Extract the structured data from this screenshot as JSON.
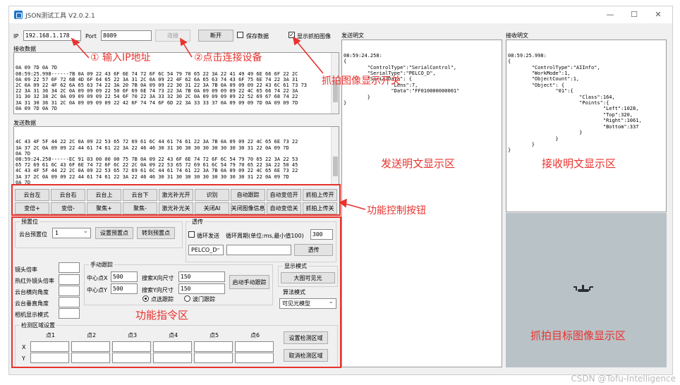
{
  "window": {
    "title": "JSON测试工具 V2.0.2.1",
    "minimize": "—",
    "maximize": "☐",
    "close": "✕"
  },
  "connection": {
    "ip_label": "IP",
    "ip_value": "192.168.1.178",
    "port_label": "Port",
    "port_value": "8089",
    "connect": "连接",
    "disconnect": "断开",
    "save_data": "保存数据",
    "save_data_checked": false,
    "show_capture": "显示抓拍图像",
    "show_capture_checked": true
  },
  "recv_data": {
    "label": "接收数据",
    "text": "0A 09 7D 0A 7D\n08:59:25.998------7B 0A 09 22 43 6F 6E 74 72 6F 6C 54 79 70 65 22 3A 22 41 49 49 6E 66 6F 22 2C\n0A 09 22 57 6F 72 6B 4D 6F 64 65 22 3A 31 2C 0A 09 22 4F 62 6A 65 63 74 43 6F 75 6E 74 22 3A 31\n2C 0A 09 22 4F 62 6A 65 63 74 22 3A 20 7B 0A 09 09 22 30 31 22 3A 7B 0A 09 09 09 22 43 6C 61 73 73\n22 3A 31 36 34 2C 0A 09 09 09 22 50 6F 69 6E 74 73 22 3A 7B 0A 09 09 09 09 22 4C 65 66 74 22 3A\n31 30 32 38 2C 0A 09 09 09 09 22 54 6F 70 22 3A 33 32 30 2C 0A 09 09 09 09 22 52 69 67 68 74 22\n3A 31 30 36 31 2C 0A 09 09 09 09 22 42 6F 74 74 6F 6D 22 3A 33 33 37 0A 09 09 09 7D 0A 09 09 7D\n0A 09 7D 0A 7D"
  },
  "send_data": {
    "label": "发送数据",
    "text": "4C 43 4F 5F 44 22 2C 0A 09 22 53 65 72 69 61 6C 44 61 74 61 22 3A 7B 0A 09 09 22 4C 65 6E 73 22\n3A 37 2C 0A 09 09 22 44 61 74 61 22 3A 22 46 46 30 31 30 30 30 30 30 30 30 30 31 22 0A 09 7D\n0A 7D\n08:59:24.258------EC 91 03 00 00 00 75 7B 0A 09 22 43 6F 6E 74 72 6F 6C 54 79 70 65 22 3A 22 53\n65 72 69 61 6C 43 6F 6E 74 72 6F 6C 22 2C 0A 09 22 53 65 72 69 61 6C 54 79 70 65 22 3A 22 50 45\n4C 43 4F 5F 44 22 2C 0A 09 22 53 65 72 69 61 6C 44 61 74 61 22 3A 7B 0A 09 09 22 4C 65 6E 73 22\n3A 37 2C 0A 09 09 22 44 61 74 61 22 3A 22 46 46 30 31 30 30 30 30 30 30 30 30 31 22 0A 09 7D\n0A 7D"
  },
  "send_plain": {
    "label": "发送明文",
    "text": "08:59:24.258:\n{\n        \"ControlType\":\"SerialControl\",\n        \"SerialType\":\"PELCO_D\",\n        \"SerialData\": {\n                \"Lens\":7,\n                \"Data\":\"FF010000000001\"\n        }\n}"
  },
  "recv_plain": {
    "label": "接收明文",
    "text": "08:59:25.998:\n{\n        \"ControlType\":\"AIInfo\",\n        \"WorkMode\":1,\n        \"ObjectCount\":1,\n        \"Object\": {\n                \"01\":{\n                        \"Class\":164,\n                        \"Points\":{\n                                \"Left\":1028,\n                                \"Top\":320,\n                                \"Right\":1061,\n                                \"Bottom\":337\n                        }\n                }\n        }\n}"
  },
  "control_buttons": {
    "row1": [
      "云台左",
      "云台右",
      "云台上",
      "云台下",
      "激光补光开",
      "识别",
      "自动跟踪",
      "自动变倍开",
      "抓拍上传开"
    ],
    "row2": [
      "变倍+",
      "变倍-",
      "聚焦+",
      "聚焦-",
      "激光补光关",
      "关闭AI",
      "关闭图像信息",
      "自动变倍关",
      "抓拍上传关"
    ]
  },
  "preset": {
    "group": "预置位",
    "label": "云台预置位",
    "value": "1",
    "set": "设置预置点",
    "goto": "转到预置点"
  },
  "passthrough": {
    "group": "透传",
    "loop_send": "循环发送",
    "loop_send_checked": false,
    "period_label": "循环周期(单位:ms,最小值100)",
    "period_value": "300",
    "protocol": "PELCO_D",
    "input_value": "",
    "send": "透传"
  },
  "lens": {
    "zoom": "镜头倍率",
    "ir_zoom": "热红外镜头倍率",
    "pan": "云台横向角度",
    "tilt": "云台垂直角度",
    "camera_mode": "相机显示模式"
  },
  "manual_track": {
    "group": "手动跟踪",
    "cx_label": "中心点X",
    "cx_value": "500",
    "cy_label": "中心点Y",
    "cy_value": "500",
    "sx_label": "搜索X向尺寸",
    "sx_value": "150",
    "sy_label": "搜索Y向尺寸",
    "sy_value": "150",
    "start": "启动手动跟踪",
    "mode_point": "点选跟踪",
    "mode_point_checked": true,
    "mode_box": "波门跟踪",
    "mode_box_checked": false
  },
  "display": {
    "group": "显示模式",
    "button": "大图可见光",
    "algo_label": "算法模式",
    "algo_value": "可见光模型"
  },
  "detect_area": {
    "group": "检测区域设置",
    "points": [
      "点1",
      "点2",
      "点3",
      "点4",
      "点5",
      "点6"
    ],
    "x_label": "X",
    "y_label": "Y",
    "set": "设置检测区域",
    "cancel": "取消检测区域"
  },
  "annotations": {
    "ip": "① 输入IP地址",
    "connect": "②点击连接设备",
    "capture": "抓拍图像显示开关",
    "controls": "功能控制按钮",
    "commands": "功能指令区",
    "send_plain": "发送明文显示区",
    "recv_plain": "接收明文显示区",
    "capture_area": "抓拍目标图像显示区",
    "color": "#e8322d"
  },
  "watermark": "CSDN @Tofu-Intelligence"
}
